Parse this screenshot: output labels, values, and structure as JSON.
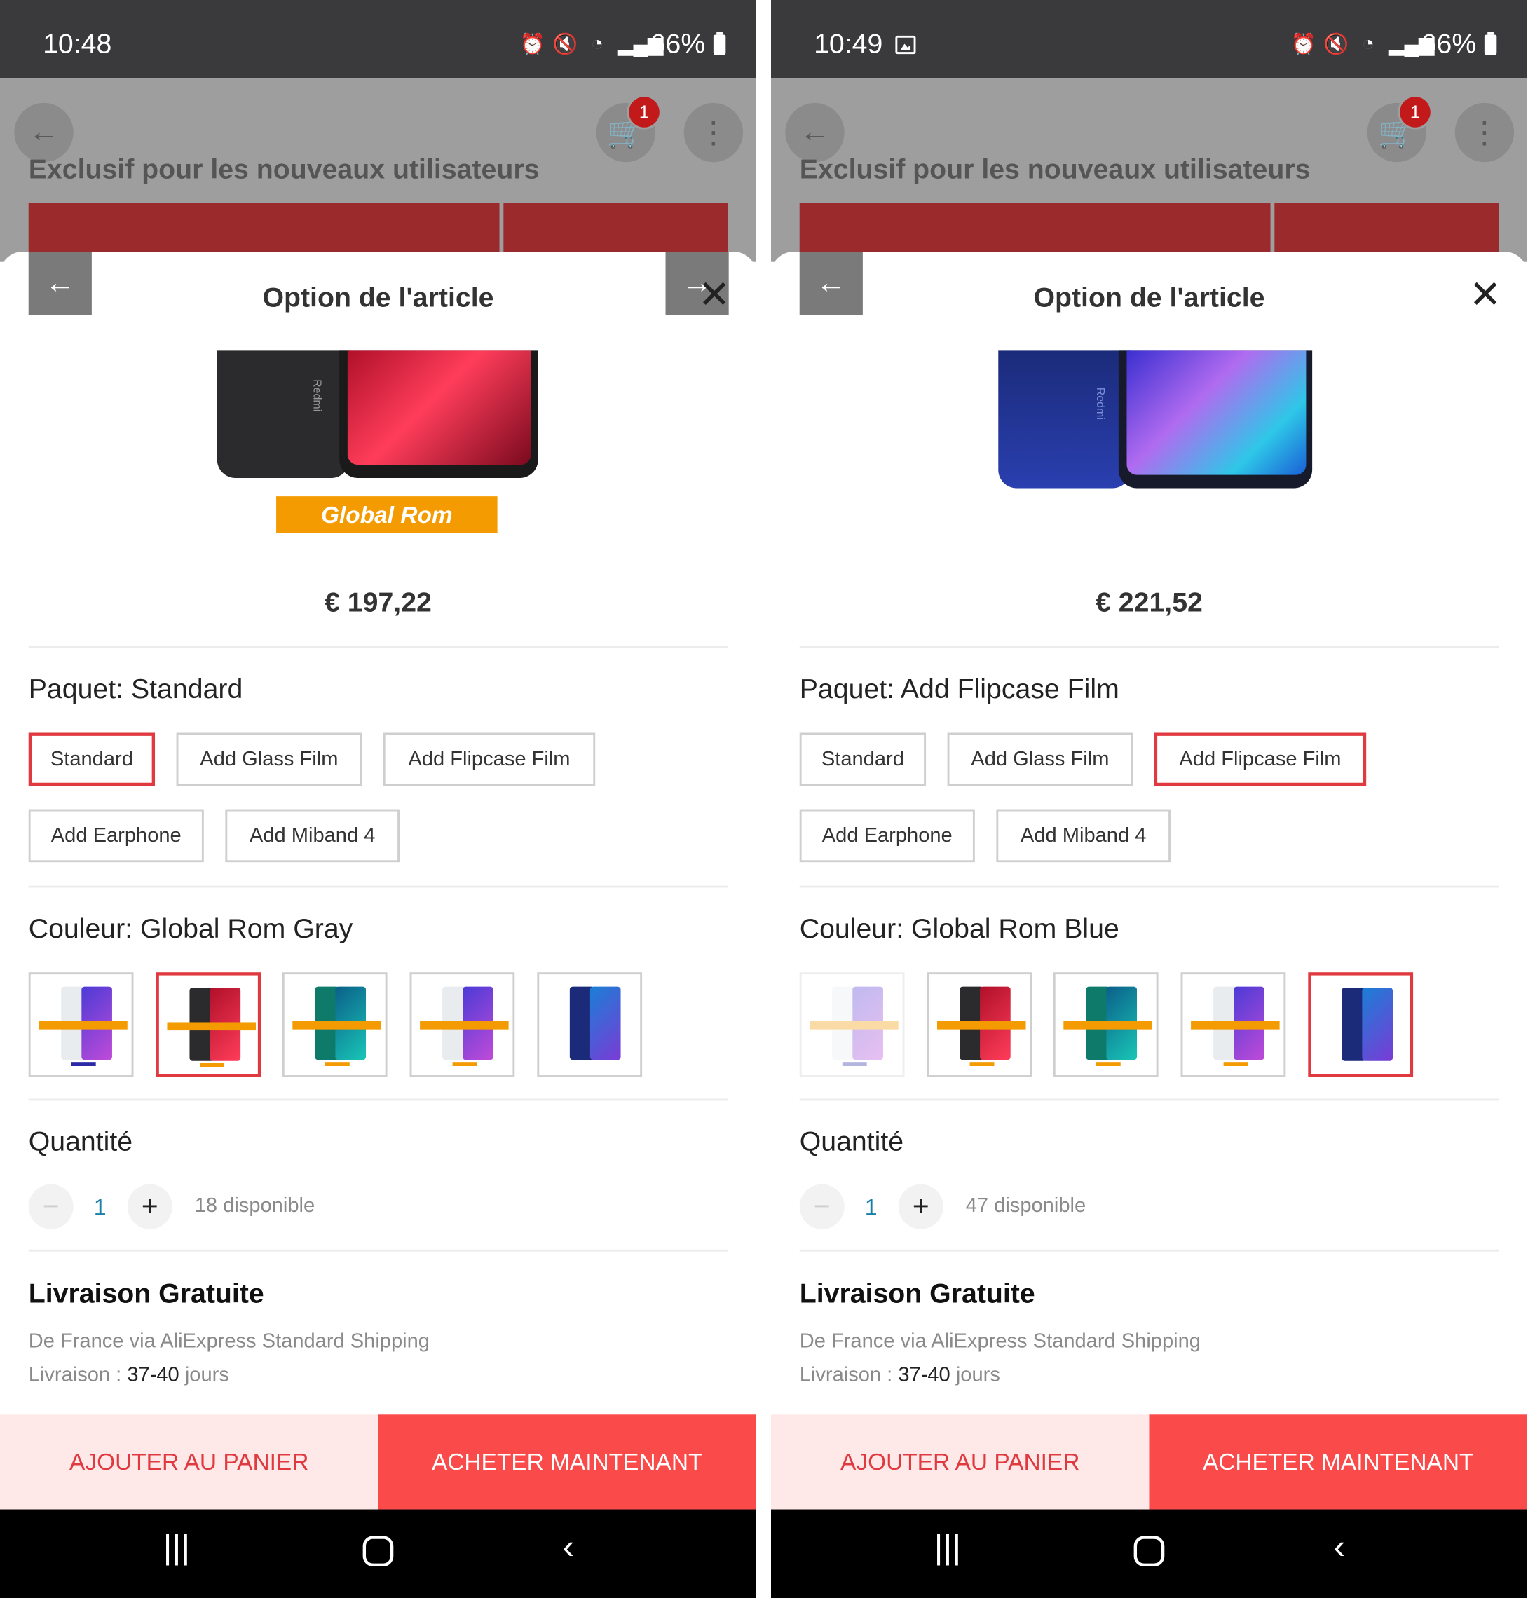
{
  "screens": [
    {
      "status": {
        "time": "10:48",
        "battery": "66%",
        "show_gallery_icon": false
      },
      "background": {
        "heading": "Exclusif pour les nouveaux utilisateurs",
        "cart_count": "1"
      },
      "sheet": {
        "title": "Option de l'article",
        "price": "€ 197,22",
        "image_badge": "Global Rom",
        "phone_brand": "Redmi",
        "package_label": "Paquet: Standard",
        "packages": [
          "Standard",
          "Add Glass Film",
          "Add Flipcase Film",
          "Add Earphone",
          "Add Miband 4"
        ],
        "selected_package": "Standard",
        "color_label": "Couleur: Global Rom Gray",
        "color_swatches": [
          "white-purple",
          "gray-red",
          "green",
          "white-purple-2",
          "blue"
        ],
        "selected_color_index": 1,
        "quantity_label": "Quantité",
        "quantity": "1",
        "available": "18 disponible",
        "shipping_title": "Livraison Gratuite",
        "shipping_from": "De France via AliExpress Standard Shipping",
        "delivery_prefix": "Livraison :",
        "delivery_days": "37-40",
        "delivery_suffix": "jours"
      },
      "actions": {
        "add_to_cart": "AJOUTER AU PANIER",
        "buy_now": "ACHETER MAINTENANT"
      }
    },
    {
      "status": {
        "time": "10:49",
        "battery": "66%",
        "show_gallery_icon": true
      },
      "background": {
        "heading": "Exclusif pour les nouveaux utilisateurs",
        "cart_count": "1"
      },
      "sheet": {
        "title": "Option de l'article",
        "price": "€ 221,52",
        "phone_brand": "Redmi",
        "package_label": "Paquet: Add Flipcase Film",
        "packages": [
          "Standard",
          "Add Glass Film",
          "Add Flipcase Film",
          "Add Earphone",
          "Add Miband 4"
        ],
        "selected_package": "Add Flipcase Film",
        "color_label": "Couleur: Global Rom Blue",
        "color_swatches": [
          "white-purple",
          "gray-red",
          "green",
          "white-purple-2",
          "blue"
        ],
        "selected_color_index": 4,
        "quantity_label": "Quantité",
        "quantity": "1",
        "available": "47 disponible",
        "shipping_title": "Livraison Gratuite",
        "shipping_from": "De France via AliExpress Standard Shipping",
        "delivery_prefix": "Livraison :",
        "delivery_days": "37-40",
        "delivery_suffix": "jours"
      },
      "actions": {
        "add_to_cart": "AJOUTER AU PANIER",
        "buy_now": "ACHETER MAINTENANT"
      }
    }
  ],
  "colors": {
    "accent": "#e0393f",
    "buy_button": "#fa4a4a",
    "cart_button_bg": "#ffe9e8",
    "badge": "#f39b00",
    "qty_value": "#1a7fa6"
  },
  "icons": {
    "status": [
      "alarm-icon",
      "mute-icon",
      "wifi-icon",
      "signal-icon",
      "battery-icon"
    ],
    "nav": [
      "recents-icon",
      "home-icon",
      "back-icon"
    ]
  }
}
